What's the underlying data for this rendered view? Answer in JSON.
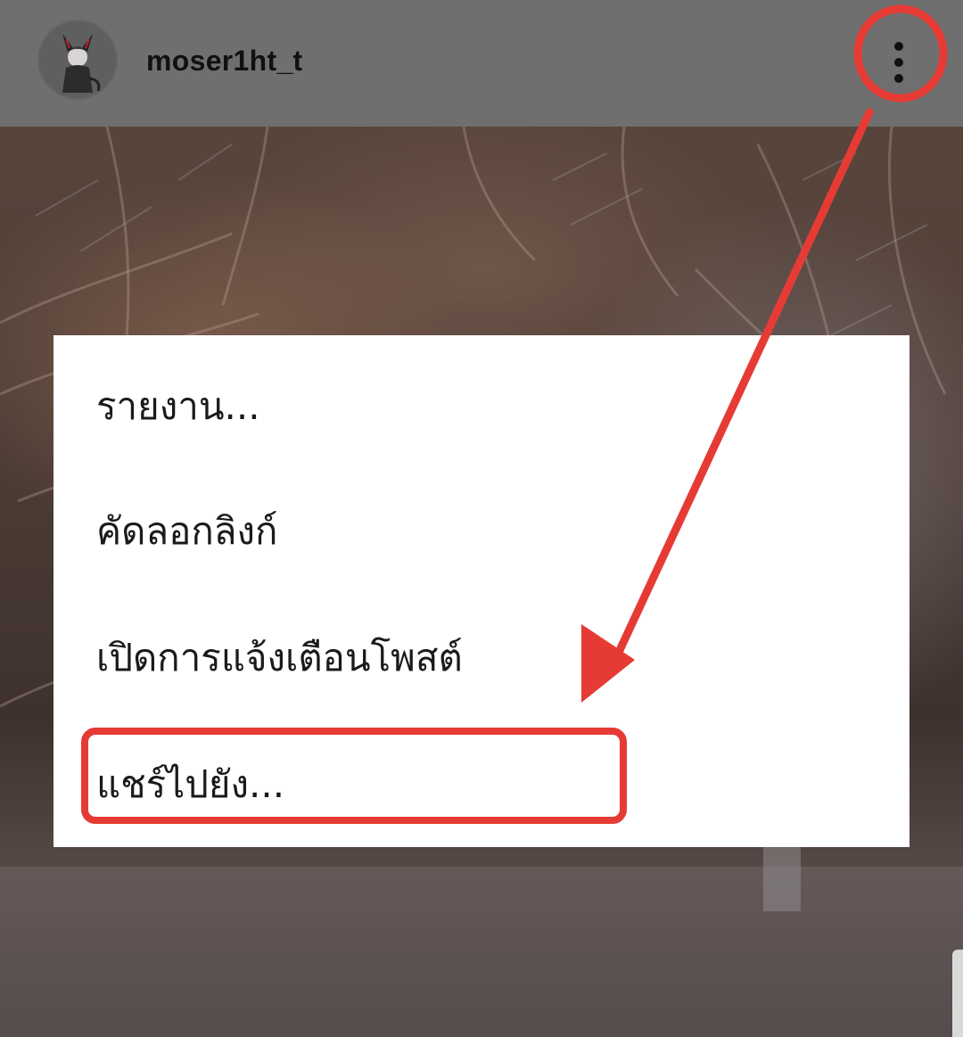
{
  "post_header": {
    "username": "moser1ht_t",
    "avatar_icon": "avatar-icon",
    "more_options_icon": "more-vertical-icon"
  },
  "menu": {
    "items": [
      {
        "label": "รายงาน..."
      },
      {
        "label": "คัดลอกลิงก์"
      },
      {
        "label": "เปิดการแจ้งเตือนโพสต์"
      },
      {
        "label": "แชร์ไปยัง..."
      }
    ]
  },
  "annotation": {
    "color": "#e63b35",
    "highlighted_item": "แชร์ไปยัง..."
  }
}
